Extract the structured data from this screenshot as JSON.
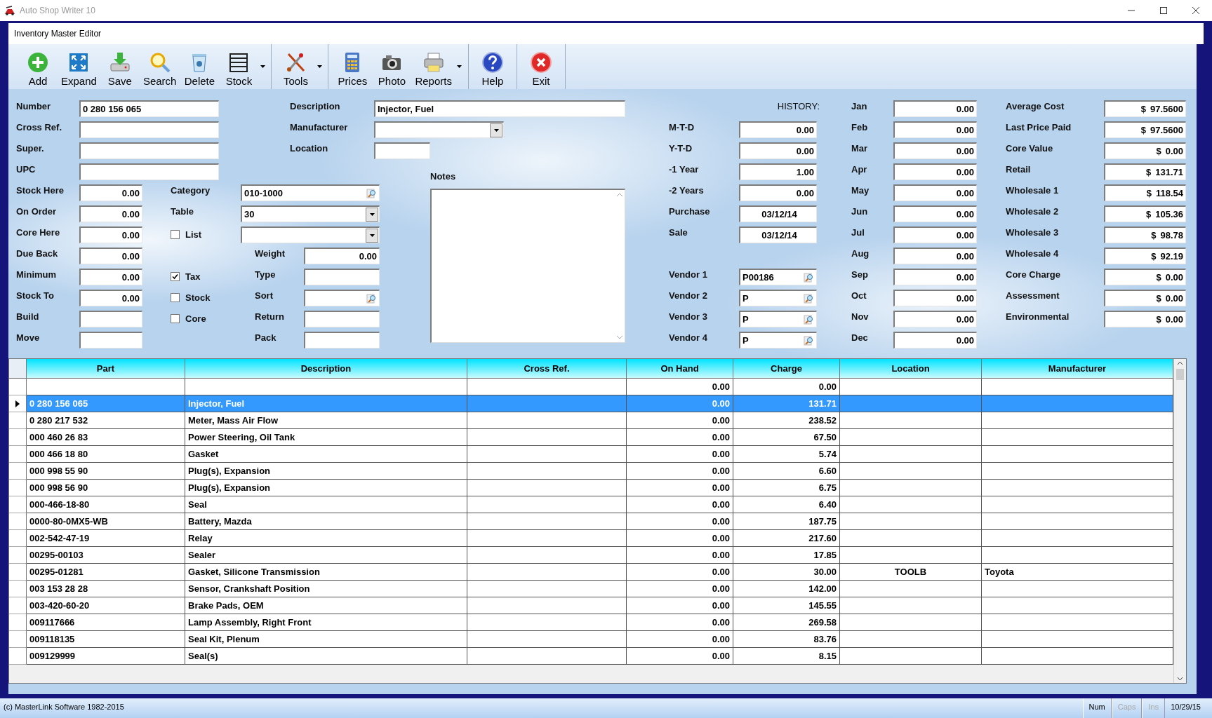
{
  "app_window": {
    "title": "Auto Shop Writer 10"
  },
  "editor_window": {
    "title": "Inventory Master Editor"
  },
  "toolbar": [
    [
      {
        "label": "Add",
        "dropdown": false
      },
      {
        "label": "Expand",
        "dropdown": false
      },
      {
        "label": "Save",
        "dropdown": false
      },
      {
        "label": "Search",
        "dropdown": false
      },
      {
        "label": "Delete",
        "dropdown": false
      },
      {
        "label": "Stock",
        "dropdown": true
      }
    ],
    [
      {
        "label": "Tools",
        "dropdown": true
      }
    ],
    [
      {
        "label": "Prices",
        "dropdown": false
      },
      {
        "label": "Photo",
        "dropdown": false
      },
      {
        "label": "Reports",
        "dropdown": true
      }
    ],
    [
      {
        "label": "Help",
        "dropdown": false
      }
    ],
    [
      {
        "label": "Exit",
        "dropdown": false
      }
    ]
  ],
  "identity": [
    {
      "label": "Number",
      "value": "0 280 156 065"
    },
    {
      "label": "Cross Ref."
    },
    {
      "label": "Super."
    },
    {
      "label": "UPC"
    }
  ],
  "quantities": [
    {
      "label": "Stock Here",
      "value": "0.00"
    },
    {
      "label": "On Order",
      "value": "0.00"
    },
    {
      "label": "Core Here",
      "value": "0.00"
    },
    {
      "label": "Due Back",
      "value": "0.00"
    },
    {
      "label": "Minimum",
      "value": "0.00"
    },
    {
      "label": "Stock To",
      "value": "0.00"
    },
    {
      "label": "Build"
    },
    {
      "label": "Move"
    }
  ],
  "classification": [
    {
      "label": "Category",
      "kind": "lookup",
      "value": "010-1000"
    },
    {
      "label": "Table",
      "kind": "combo",
      "value": "30"
    },
    {
      "label": "List",
      "kind": "check_combo",
      "checked": false
    }
  ],
  "flags": [
    {
      "label": "Tax",
      "checked": true
    },
    {
      "label": "Stock",
      "checked": false
    },
    {
      "label": "Core",
      "checked": false
    }
  ],
  "attributes": [
    {
      "label": "Weight",
      "kind": "number",
      "value": "0.00"
    },
    {
      "label": "Type",
      "kind": "text"
    },
    {
      "label": "Sort",
      "kind": "lookup"
    },
    {
      "label": "Return",
      "kind": "text"
    },
    {
      "label": "Pack",
      "kind": "text"
    }
  ],
  "description_fields": [
    {
      "label": "Description",
      "kind": "text",
      "value": "Injector, Fuel"
    },
    {
      "label": "Manufacturer",
      "kind": "combo"
    },
    {
      "label": "Location",
      "kind": "text"
    }
  ],
  "notes": {
    "label": "Notes"
  },
  "history": {
    "heading": "HISTORY:",
    "fields": [
      {
        "label": "M-T-D",
        "kind": "number",
        "value": "0.00"
      },
      {
        "label": "Y-T-D",
        "kind": "number",
        "value": "0.00"
      },
      {
        "label": "-1 Year",
        "kind": "number",
        "value": "1.00"
      },
      {
        "label": "-2 Years",
        "kind": "number",
        "value": "0.00"
      },
      {
        "label": "Purchase",
        "kind": "date",
        "value": "03/12/14"
      },
      {
        "label": "Sale",
        "kind": "date",
        "value": "03/12/14"
      }
    ],
    "vendors": [
      {
        "label": "Vendor 1",
        "value": "P00186"
      },
      {
        "label": "Vendor 2",
        "value": "P"
      },
      {
        "label": "Vendor 3",
        "value": "P"
      },
      {
        "label": "Vendor 4",
        "value": "P"
      }
    ]
  },
  "months": [
    {
      "label": "Jan",
      "value": "0.00"
    },
    {
      "label": "Feb",
      "value": "0.00"
    },
    {
      "label": "Mar",
      "value": "0.00"
    },
    {
      "label": "Apr",
      "value": "0.00"
    },
    {
      "label": "May",
      "value": "0.00"
    },
    {
      "label": "Jun",
      "value": "0.00"
    },
    {
      "label": "Jul",
      "value": "0.00"
    },
    {
      "label": "Aug",
      "value": "0.00"
    },
    {
      "label": "Sep",
      "value": "0.00"
    },
    {
      "label": "Oct",
      "value": "0.00"
    },
    {
      "label": "Nov",
      "value": "0.00"
    },
    {
      "label": "Dec",
      "value": "0.00"
    }
  ],
  "prices": [
    {
      "label": "Average Cost",
      "currency": "$",
      "value": "97.5600"
    },
    {
      "label": "Last Price Paid",
      "currency": "$",
      "value": "97.5600"
    },
    {
      "label": "Core Value",
      "currency": "$",
      "value": "0.00"
    },
    {
      "label": "Retail",
      "currency": "$",
      "value": "131.71"
    },
    {
      "label": "Wholesale 1",
      "currency": "$",
      "value": "118.54"
    },
    {
      "label": "Wholesale 2",
      "currency": "$",
      "value": "105.36"
    },
    {
      "label": "Wholesale 3",
      "currency": "$",
      "value": "98.78"
    },
    {
      "label": "Wholesale 4",
      "currency": "$",
      "value": "92.19"
    },
    {
      "label": "Core Charge",
      "currency": "$",
      "value": "0.00"
    },
    {
      "label": "Assessment",
      "currency": "$",
      "value": "0.00"
    },
    {
      "label": "Environmental",
      "currency": "$",
      "value": "0.00"
    }
  ],
  "table": {
    "columns": [
      "Part",
      "Description",
      "Cross Ref.",
      "On Hand",
      "Charge",
      "Location",
      "Manufacturer"
    ],
    "rows": [
      {
        "selected": false,
        "on_hand": "0.00",
        "charge": "0.00"
      },
      {
        "selected": true,
        "part": "0 280 156 065",
        "description": "Injector, Fuel",
        "on_hand": "0.00",
        "charge": "131.71"
      },
      {
        "selected": false,
        "part": "0 280 217 532",
        "description": "Meter, Mass Air Flow",
        "on_hand": "0.00",
        "charge": "238.52"
      },
      {
        "selected": false,
        "part": "000 460 26 83",
        "description": "Power Steering, Oil Tank",
        "on_hand": "0.00",
        "charge": "67.50"
      },
      {
        "selected": false,
        "part": "000 466 18 80",
        "description": "Gasket",
        "on_hand": "0.00",
        "charge": "5.74"
      },
      {
        "selected": false,
        "part": "000 998 55 90",
        "description": "Plug(s), Expansion",
        "on_hand": "0.00",
        "charge": "6.60"
      },
      {
        "selected": false,
        "part": "000 998 56 90",
        "description": "Plug(s), Expansion",
        "on_hand": "0.00",
        "charge": "6.75"
      },
      {
        "selected": false,
        "part": "000-466-18-80",
        "description": "Seal",
        "on_hand": "0.00",
        "charge": "6.40"
      },
      {
        "selected": false,
        "part": "0000-80-0MX5-WB",
        "description": "Battery, Mazda",
        "on_hand": "0.00",
        "charge": "187.75"
      },
      {
        "selected": false,
        "part": "002-542-47-19",
        "description": "Relay",
        "on_hand": "0.00",
        "charge": "217.60"
      },
      {
        "selected": false,
        "part": "00295-00103",
        "description": "Sealer",
        "on_hand": "0.00",
        "charge": "17.85"
      },
      {
        "selected": false,
        "part": "00295-01281",
        "description": "Gasket, Silicone Transmission",
        "on_hand": "0.00",
        "charge": "30.00",
        "location": "TOOLB",
        "manufacturer": "Toyota"
      },
      {
        "selected": false,
        "part": "003 153 28 28",
        "description": "Sensor, Crankshaft Position",
        "on_hand": "0.00",
        "charge": "142.00"
      },
      {
        "selected": false,
        "part": "003-420-60-20",
        "description": "Brake Pads, OEM",
        "on_hand": "0.00",
        "charge": "145.55"
      },
      {
        "selected": false,
        "part": "009117666",
        "description": "Lamp Assembly, Right Front",
        "on_hand": "0.00",
        "charge": "269.58"
      },
      {
        "selected": false,
        "part": "009118135",
        "description": "Seal Kit, Plenum",
        "on_hand": "0.00",
        "charge": "83.76"
      },
      {
        "selected": false,
        "part": "009129999",
        "description": "Seal(s)",
        "on_hand": "0.00",
        "charge": "8.15"
      }
    ]
  },
  "status_bar": {
    "copyright": "(c) MasterLink Software 1982-2015",
    "indicators": [
      {
        "label": "Num",
        "on": true
      },
      {
        "label": "Caps",
        "on": false
      },
      {
        "label": "Ins",
        "on": false
      }
    ],
    "date": "10/29/15"
  }
}
